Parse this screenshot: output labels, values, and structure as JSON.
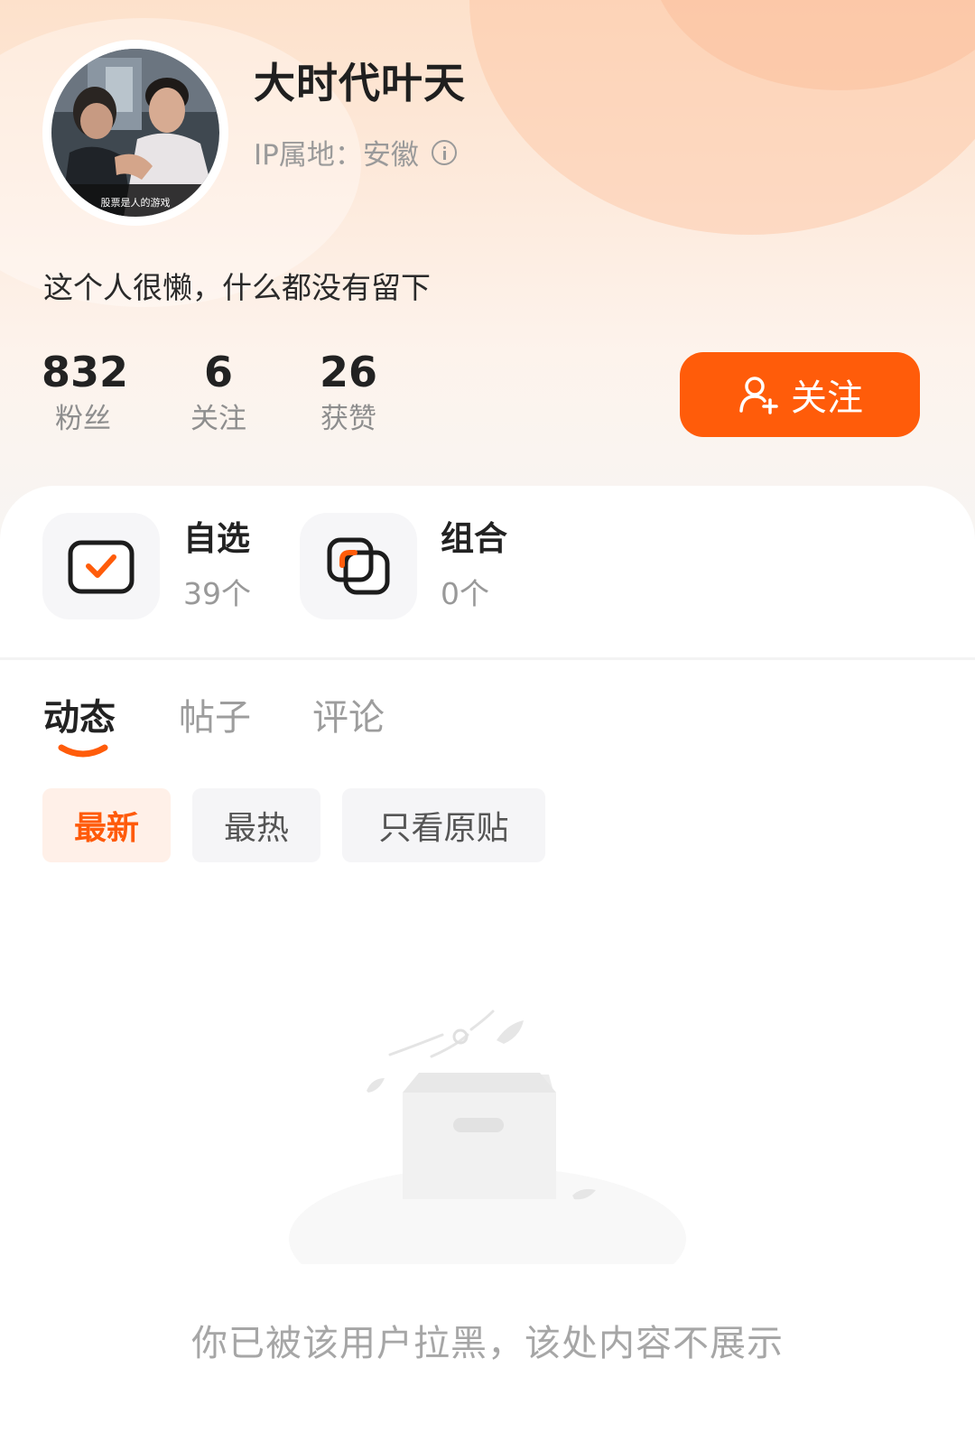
{
  "profile": {
    "username": "大时代叶天",
    "ip_location": "IP属地：安徽",
    "bio": "这个人很懒，什么都没有留下",
    "avatar_caption": "股票是人的游戏"
  },
  "stats": {
    "fans": {
      "value": "832",
      "label": "粉丝"
    },
    "following": {
      "value": "6",
      "label": "关注"
    },
    "likes": {
      "value": "26",
      "label": "获赞"
    }
  },
  "follow_button": {
    "label": "关注"
  },
  "quick_links": [
    {
      "title": "自选",
      "count": "39个",
      "icon": "watchlist-check-icon"
    },
    {
      "title": "组合",
      "count": "0个",
      "icon": "portfolio-icon"
    }
  ],
  "tabs": [
    {
      "label": "动态",
      "active": true
    },
    {
      "label": "帖子",
      "active": false
    },
    {
      "label": "评论",
      "active": false
    }
  ],
  "filters": [
    {
      "label": "最新",
      "active": true
    },
    {
      "label": "最热",
      "active": false
    },
    {
      "label": "只看原贴",
      "active": false
    }
  ],
  "empty_state": {
    "message": "你已被该用户拉黑，该处内容不展示",
    "icon": "empty-box-icon"
  },
  "colors": {
    "accent": "#ff5c0a",
    "accent_light": "#fff0e8",
    "muted_text": "#9d9d9d"
  }
}
